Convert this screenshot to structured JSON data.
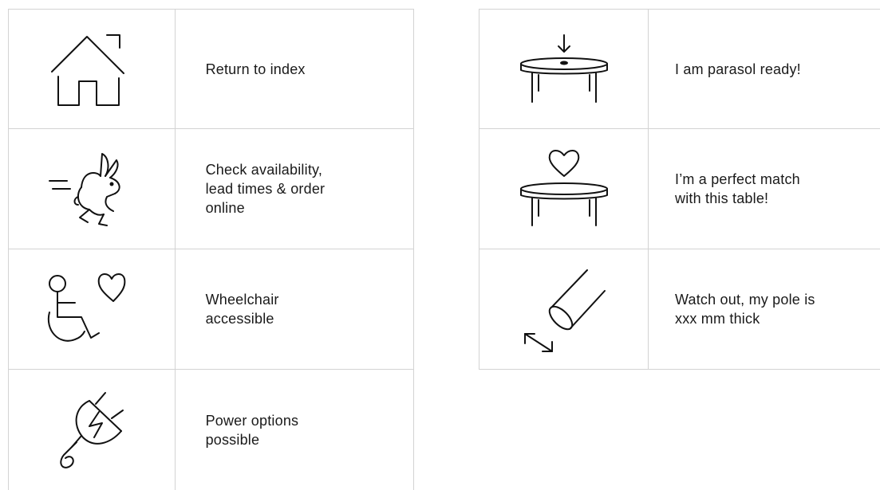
{
  "left_features": [
    {
      "label": "Return to index",
      "icon": "house-icon"
    },
    {
      "label": "Check availability,\nlead times & order\nonline",
      "icon": "running-rabbit-icon"
    },
    {
      "label": "Wheelchair\naccessible",
      "icon": "wheelchair-heart-icon"
    },
    {
      "label": "Power options\npossible",
      "icon": "power-plug-icon"
    }
  ],
  "right_features": [
    {
      "label": "I am parasol ready!",
      "icon": "parasol-table-icon"
    },
    {
      "label": "I’m a perfect match\nwith this table!",
      "icon": "table-heart-icon"
    },
    {
      "label": "Watch out, my pole is\nxxx mm thick",
      "icon": "pole-thickness-icon"
    }
  ],
  "colors": {
    "border": "#d3d3d3",
    "ink": "#111111"
  }
}
